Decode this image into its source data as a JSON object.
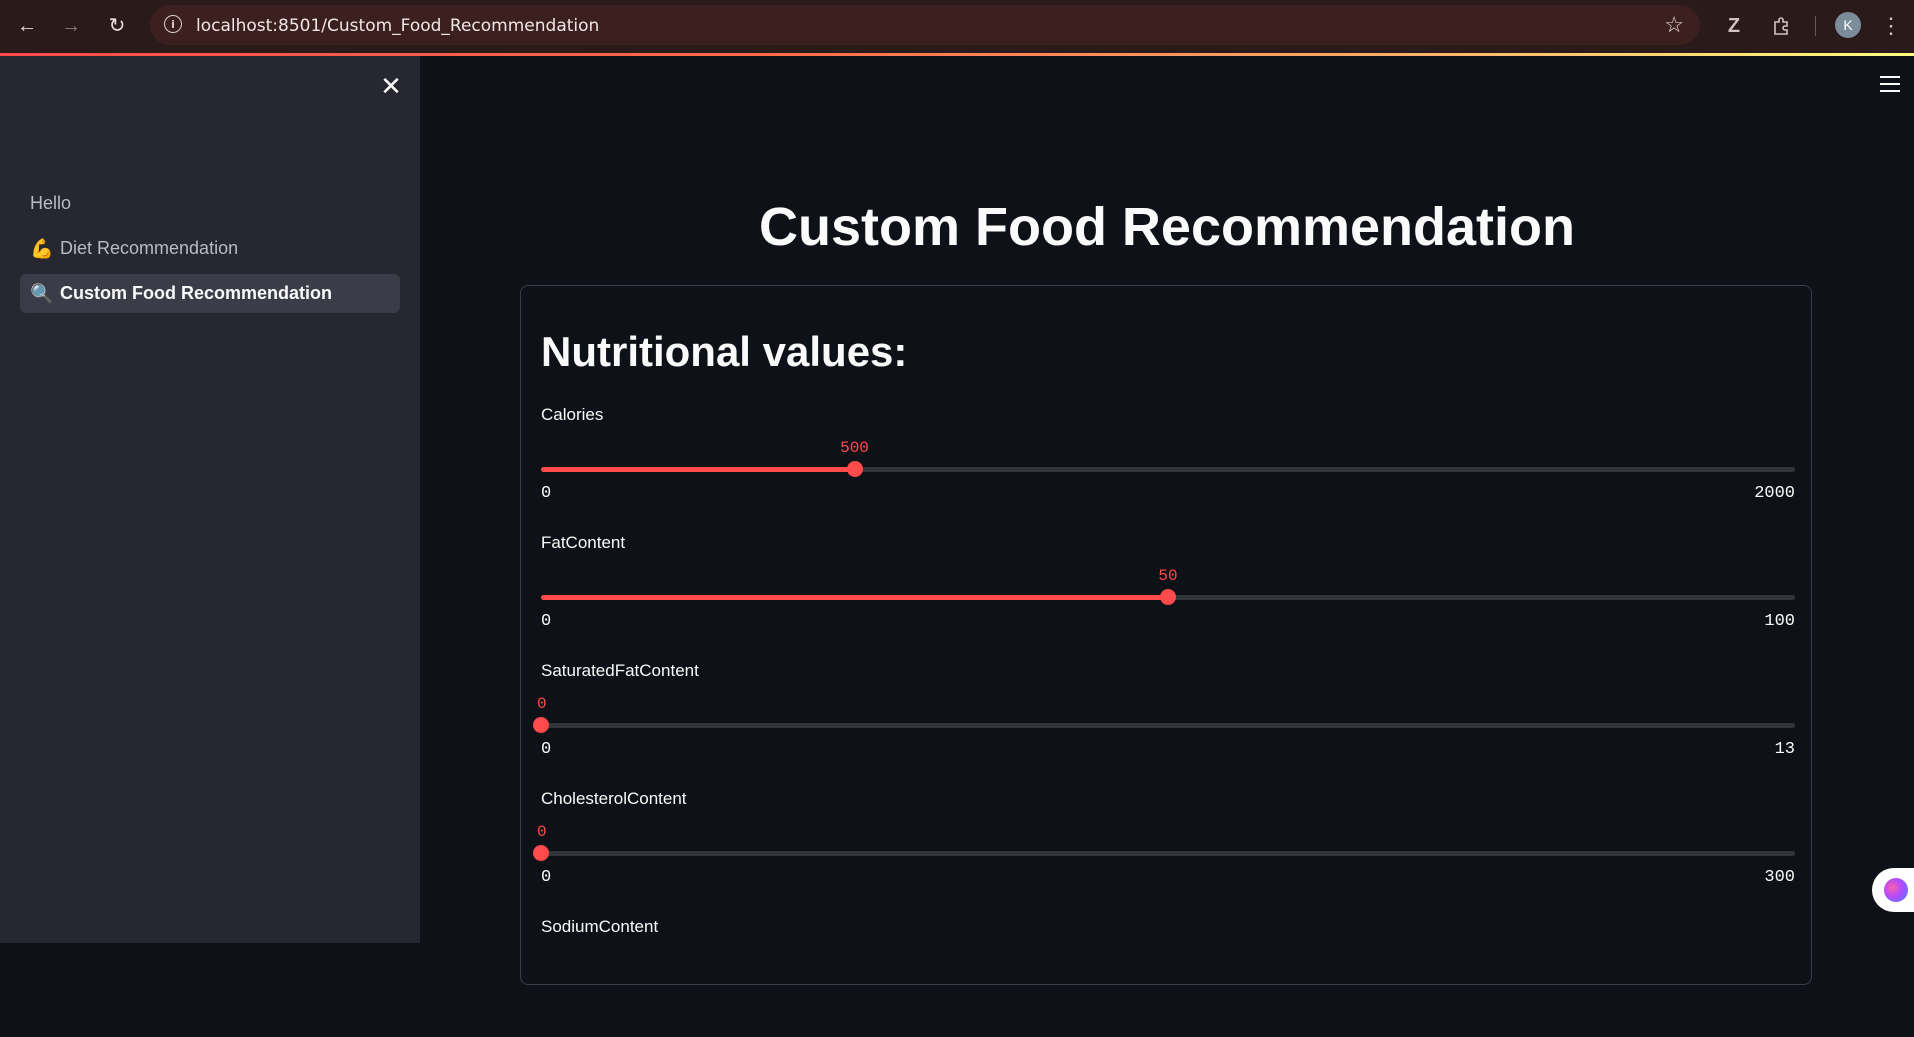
{
  "browser": {
    "url": "localhost:8501/Custom_Food_Recommendation",
    "profile_initial": "K"
  },
  "sidebar": {
    "items": [
      {
        "label": "Hello",
        "emoji": "",
        "active": false
      },
      {
        "label": "Diet Recommendation",
        "emoji": "💪",
        "active": false
      },
      {
        "label": "Custom Food Recommendation",
        "emoji": "🔍",
        "active": true
      }
    ]
  },
  "main": {
    "title": "Custom Food Recommendation",
    "form_heading": "Nutritional values:",
    "sliders": [
      {
        "label": "Calories",
        "value": "500",
        "min": "0",
        "max": "2000",
        "fraction": 0.25
      },
      {
        "label": "FatContent",
        "value": "50",
        "min": "0",
        "max": "100",
        "fraction": 0.5
      },
      {
        "label": "SaturatedFatContent",
        "value": "0",
        "min": "0",
        "max": "13",
        "fraction": 0
      },
      {
        "label": "CholesterolContent",
        "value": "0",
        "min": "0",
        "max": "300",
        "fraction": 0
      },
      {
        "label": "SodiumContent",
        "value": "",
        "min": "",
        "max": "",
        "fraction": 0
      }
    ]
  },
  "colors": {
    "accent": "#ff4b4b",
    "sidebar_bg": "#262730",
    "main_bg": "#0e1117"
  }
}
